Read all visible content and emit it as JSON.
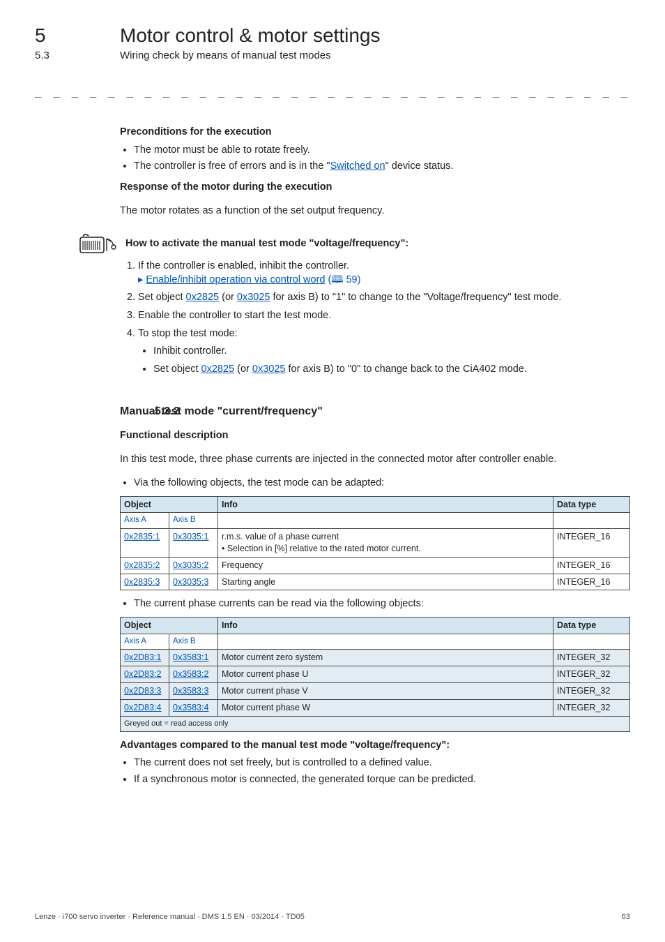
{
  "header": {
    "chapter_num": "5",
    "chapter_title": "Motor control & motor settings",
    "section_num": "5.3",
    "section_title": "Wiring check by means of manual test modes"
  },
  "dashline": "_ _ _ _ _ _ _ _ _ _ _ _ _ _ _ _ _ _ _ _ _ _ _ _ _ _ _ _ _ _ _ _ _ _ _ _ _ _ _ _ _ _ _ _ _ _ _ _ _ _ _ _ _ _ _ _ _ _ _ _ _ _ _ _",
  "precond": {
    "heading": "Preconditions for the execution",
    "bullets": [
      "The motor must be able to rotate freely.",
      {
        "pre": "The controller is free of errors and is in the \"",
        "link": "Switched on",
        "post": "\" device status."
      }
    ]
  },
  "response": {
    "heading": "Response of the motor during the execution",
    "body": "The motor rotates as a function of the set output frequency."
  },
  "howto": {
    "heading": "How to activate the manual test mode \"voltage/frequency\":",
    "steps": [
      {
        "text": "If the controller is enabled, inhibit the controller.",
        "sublink_label": "Enable/inhibit operation via control word",
        "sublink_ref": "59"
      },
      {
        "parts": [
          {
            "t": "Set object "
          },
          {
            "l": "0x2825"
          },
          {
            "t": " (or "
          },
          {
            "l": "0x3025"
          },
          {
            "t": " for axis B) to \"1\" to change to the \"Voltage/frequency\" test mode."
          }
        ]
      },
      {
        "text": "Enable the controller to start the test mode."
      },
      {
        "text": "To stop the test mode:",
        "subs": [
          {
            "text": "Inhibit controller."
          },
          {
            "parts": [
              {
                "t": "Set object "
              },
              {
                "l": "0x2825"
              },
              {
                "t": " (or "
              },
              {
                "l": "0x3025"
              },
              {
                "t": " for axis B) to \"0\" to change back to the CiA402 mode."
              }
            ]
          }
        ]
      }
    ]
  },
  "sec532": {
    "num": "5.3.2",
    "title": "Manual test mode \"current/frequency\"",
    "func_desc_heading": "Functional description",
    "func_desc_body": "In this test mode, three phase currents are injected in the connected motor after controller enable.",
    "bullet_via": "Via the following objects, the test mode can be adapted:"
  },
  "table1": {
    "headers": {
      "object": "Object",
      "info": "Info",
      "dtype": "Data type",
      "axisA": "Axis A",
      "axisB": "Axis B"
    },
    "rows": [
      {
        "a": "0x2835:1",
        "b": "0x3035:1",
        "info_l1": "r.m.s. value of a phase current",
        "info_l2": "• Selection in [%] relative to the rated motor current.",
        "d": "INTEGER_16"
      },
      {
        "a": "0x2835:2",
        "b": "0x3035:2",
        "info_l1": "Frequency",
        "info_l2": "",
        "d": "INTEGER_16"
      },
      {
        "a": "0x2835:3",
        "b": "0x3035:3",
        "info_l1": "Starting angle",
        "info_l2": "",
        "d": "INTEGER_16"
      }
    ]
  },
  "bullet_current": "The current phase currents can be read via the following objects:",
  "table2": {
    "headers": {
      "object": "Object",
      "info": "Info",
      "dtype": "Data type",
      "axisA": "Axis A",
      "axisB": "Axis B"
    },
    "rows": [
      {
        "a": "0x2D83:1",
        "b": "0x3583:1",
        "info": "Motor current zero system",
        "d": "INTEGER_32"
      },
      {
        "a": "0x2D83:2",
        "b": "0x3583:2",
        "info": "Motor current phase U",
        "d": "INTEGER_32"
      },
      {
        "a": "0x2D83:3",
        "b": "0x3583:3",
        "info": "Motor current phase V",
        "d": "INTEGER_32"
      },
      {
        "a": "0x2D83:4",
        "b": "0x3583:4",
        "info": "Motor current phase W",
        "d": "INTEGER_32"
      }
    ],
    "footnote": "Greyed out = read access only"
  },
  "adv": {
    "heading": "Advantages compared to the manual test mode \"voltage/frequency\":",
    "bullets": [
      "The current does not set freely, but is controlled to a defined value.",
      "If a synchronous motor is connected, the generated torque can be predicted."
    ]
  },
  "footer": {
    "left": "Lenze · i700 servo inverter · Reference manual · DMS 1.5 EN · 03/2014 · TD05",
    "right": "63"
  }
}
